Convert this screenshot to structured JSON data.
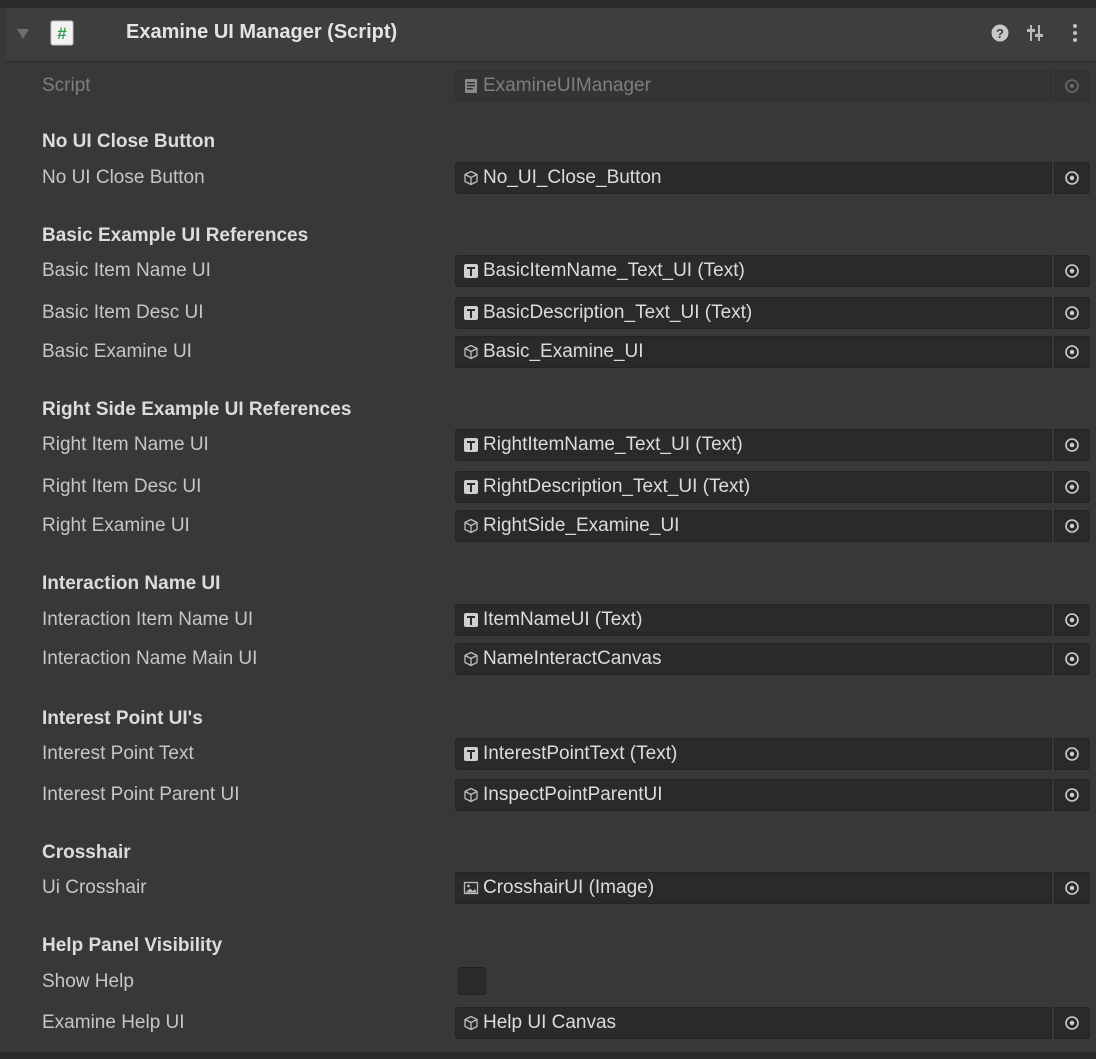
{
  "header": {
    "title": "Examine UI Manager (Script)",
    "script_badge": "#"
  },
  "icons": {
    "foldout": "foldout-triangle-icon",
    "help": "help-icon",
    "presets": "presets-icon",
    "menu": "kebab-menu-icon",
    "script_asset": "script-asset-icon",
    "gameobject": "gameobject-icon",
    "text_component": "text-component-icon",
    "image_component": "image-component-icon",
    "object_picker": "object-picker-icon"
  },
  "colors": {
    "background": "#383838",
    "field_bg": "#2a2a2a",
    "script_badge": "#3d9a4f"
  },
  "script_row": {
    "label": "Script",
    "value": "ExamineUIManager"
  },
  "sections": {
    "no_ui_close": {
      "header": "No UI Close Button",
      "rows": [
        {
          "label": "No UI Close Button",
          "value": "No_UI_Close_Button"
        }
      ]
    },
    "basic": {
      "header": "Basic Example UI References",
      "rows": [
        {
          "label": "Basic Item Name UI",
          "value": "BasicItemName_Text_UI (Text)"
        },
        {
          "label": "Basic Item Desc UI",
          "value": "BasicDescription_Text_UI (Text)"
        },
        {
          "label": "Basic Examine UI",
          "value": "Basic_Examine_UI"
        }
      ]
    },
    "right": {
      "header": "Right Side Example UI References",
      "rows": [
        {
          "label": "Right Item Name UI",
          "value": "RightItemName_Text_UI (Text)"
        },
        {
          "label": "Right Item Desc UI",
          "value": "RightDescription_Text_UI (Text)"
        },
        {
          "label": "Right Examine UI",
          "value": "RightSide_Examine_UI"
        }
      ]
    },
    "interaction": {
      "header": "Interaction Name UI",
      "rows": [
        {
          "label": "Interaction Item Name UI",
          "value": "ItemNameUI (Text)"
        },
        {
          "label": "Interaction Name Main UI",
          "value": "NameInteractCanvas"
        }
      ]
    },
    "interest": {
      "header": "Interest Point UI's",
      "rows": [
        {
          "label": "Interest Point Text",
          "value": "InterestPointText (Text)"
        },
        {
          "label": "Interest Point Parent UI",
          "value": "InspectPointParentUI"
        }
      ]
    },
    "crosshair": {
      "header": "Crosshair",
      "rows": [
        {
          "label": "Ui Crosshair",
          "value": "CrosshairUI (Image)"
        }
      ]
    },
    "help": {
      "header": "Help Panel Visibility",
      "show_help": {
        "label": "Show Help",
        "checked": false
      },
      "rows": [
        {
          "label": "Examine Help UI",
          "value": "Help UI Canvas"
        }
      ]
    }
  }
}
